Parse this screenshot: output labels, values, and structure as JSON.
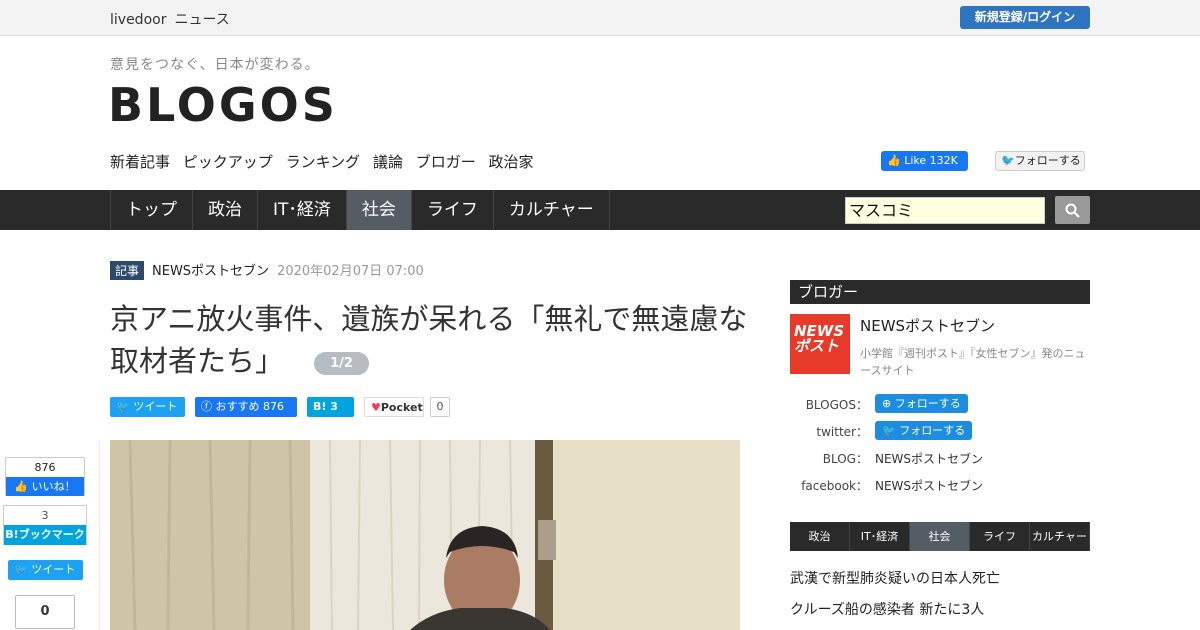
{
  "topbar": {
    "brand1": "livedoor",
    "brand2": "ニュース",
    "register_login": "新規登録/ログイン"
  },
  "header": {
    "tagline": "意見をつなぐ、日本が変わる。",
    "logo": "BLOGOS"
  },
  "subnav": {
    "items": [
      "新着記事",
      "ピックアップ",
      "ランキング",
      "議論",
      "ブロガー",
      "政治家"
    ]
  },
  "social_top": {
    "fb_like_label": "Like",
    "fb_like_count": "132K",
    "twitter_follow": "フォローする"
  },
  "mainnav": {
    "tabs": [
      "トップ",
      "政治",
      "IT･経済",
      "社会",
      "ライフ",
      "カルチャー"
    ],
    "active": "社会"
  },
  "search": {
    "value": "マスコミ"
  },
  "article": {
    "tag": "記事",
    "source": "NEWSポストセブン",
    "date": "2020年02月07日 07:00",
    "title": "京アニ放火事件、遺族が呆れる「無礼で無遠慮な取材者たち」",
    "page_indicator": "1/2"
  },
  "share": {
    "tweet": "ツイート",
    "fb_recommend": "おすすめ",
    "fb_count": "876",
    "hatena_count": "3",
    "pocket": "Pocket",
    "pocket_count": "0"
  },
  "side_share": {
    "like_count": "876",
    "like_label": "いいね！",
    "hatena_count": "3",
    "hatena_label": "ブックマーク",
    "tweet": "ツイート",
    "pocket_count": "0"
  },
  "sidebar": {
    "heading": "ブロガー",
    "blogger_logo": "NEWSポスト",
    "blogger_name": "NEWSポストセブン",
    "blogger_desc": "小学館『週刊ポスト』『女性セブン』発のニュースサイト",
    "rows": [
      {
        "key": "BLOGOS：",
        "value": "フォローする"
      },
      {
        "key": "twitter：",
        "value": "フォローする"
      },
      {
        "key": "BLOG：",
        "value": "NEWSポストセブン"
      },
      {
        "key": "facebook：",
        "value": "NEWSポストセブン"
      }
    ],
    "cat_tabs": [
      "政治",
      "IT･経済",
      "社会",
      "ライフ",
      "カルチャー"
    ],
    "news": [
      "武漢で新型肺炎疑いの日本人死亡",
      "クルーズ船の感染者 新たに3人"
    ]
  },
  "colors": {
    "nav_bg": "#2a2a2a",
    "active_tab": "#555c63",
    "accent_blue": "#2f74c0",
    "facebook": "#1877f2",
    "twitter": "#1da1f2",
    "hatena": "#00a4de"
  }
}
